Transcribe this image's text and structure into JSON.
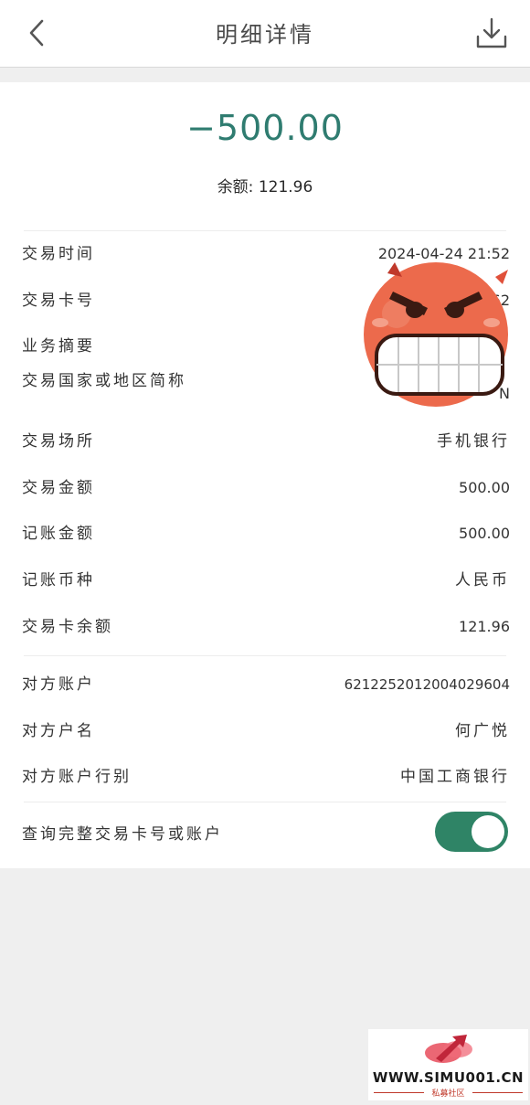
{
  "header": {
    "title": "明细详情"
  },
  "summary": {
    "amount": "−500.00",
    "balance_label": "余额:",
    "balance_value": "121.96"
  },
  "details": [
    {
      "label": "交易时间",
      "value": "2024-04-24 21:52"
    },
    {
      "label": "交易卡号",
      "value": "62"
    },
    {
      "label": "业务摘要",
      "value": ""
    },
    {
      "label": "交易国家或地区简称",
      "value": "N"
    },
    {
      "label": "交易场所",
      "value": "手机银行"
    },
    {
      "label": "交易金额",
      "value": "500.00"
    },
    {
      "label": "记账金额",
      "value": "500.00"
    },
    {
      "label": "记账币种",
      "value": "人民币"
    },
    {
      "label": "交易卡余额",
      "value": "121.96"
    }
  ],
  "counterparty": [
    {
      "label": "对方账户",
      "value": "6212252012004029604"
    },
    {
      "label": "对方户名",
      "value": "何广悦"
    },
    {
      "label": "对方账户行别",
      "value": "中国工商银行"
    }
  ],
  "toggle_row": {
    "label": "查询完整交易卡号或账户",
    "enabled": true
  },
  "icons": {
    "back": "chevron-left-icon",
    "download": "download-icon",
    "sticker": "angry-face-sticker"
  },
  "colors": {
    "accent": "#2f7c70",
    "toggle_on": "#2f8466",
    "background": "#efefef"
  },
  "watermark": {
    "url": "WWW.SIMU001.CN",
    "subtitle": "私募社区"
  }
}
